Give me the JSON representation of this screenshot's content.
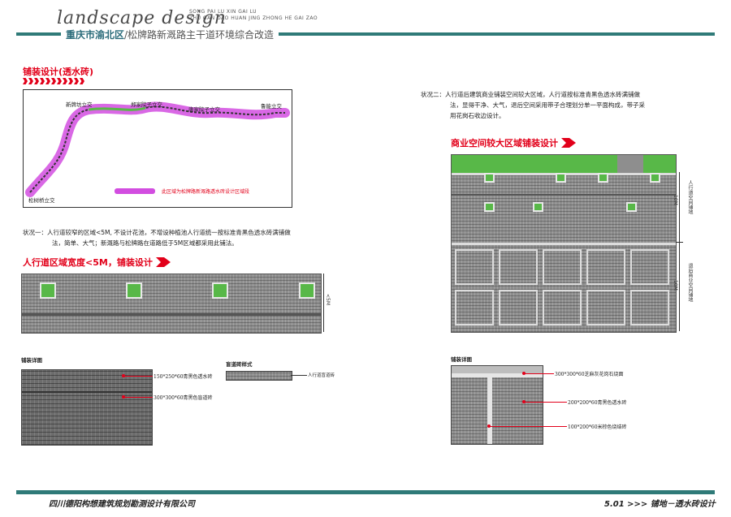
{
  "header": {
    "script_title": "landscape design",
    "pinyin_line1": "SONG PAI LU  XIN GAI LU",
    "pinyin_line2": "ZHU GAN DAO HUAN JING ZHONG HE GAI ZAO",
    "district": "重庆市渝北区",
    "project": "/松牌路新溉路主干道环境综合改造"
  },
  "left": {
    "section_title": "铺装设计(透水砖)",
    "map_labels": {
      "xinpaifang": "新牌坊立交",
      "zhengjiayuanzi": "郑家院子立交",
      "tangjiayuanzi": "唐家院子立交",
      "luxinglijiao": "鲁能立交",
      "songshuqiao": "松树桥立交",
      "legend": "此区域为松牌路新溉路透水砖设计区域段"
    },
    "situation1_line1": "状况一：人行道较窄的区域<5M, 不设计花池，不增设种植池人行道统一按标准青黑色透水砖满铺做",
    "situation1_line2": "法，简单、大气；新溉路与松牌路在道路低于5M区域都采用此铺法。",
    "narrow_title": "人行道区域宽度<5M，铺装设计",
    "width_label": "<5M",
    "detail_label": "铺装详图",
    "callout1": "150*250*60青黑色透水砖",
    "callout2": "300*300*60青黑色盲道砖",
    "blind_label": "盲道砖样式",
    "blind_callout": "人行道盲道砖"
  },
  "right": {
    "situation2_line1": "状况二：人行道后建筑商业铺装空间较大区域，人行道按标准青黑色透水砖满铺做",
    "situation2_line2": "法，显得干净、大气，退后空间采用带子合理划分单一平面构成，带子采",
    "situation2_line3": "用花岗石收边设计。",
    "commercial_title": "商业空间较大区域铺装设计",
    "sidewalk_label": "人行道空间铺地",
    "sidewalk_width": "10M",
    "setback_label": "退后商业空间铺地",
    "setback_width": "10M",
    "detail_label": "铺装详图",
    "callout1": "300*300*60芝麻灰花岗石烧面",
    "callout2": "200*200*60青黑色透水砖",
    "callout3": "100*200*60米棕色烧结砖"
  },
  "footer": {
    "company": "四川德阳构想建筑规划勘测设计有限公司",
    "page": "5.01 >>> 铺地－透水砖设计"
  },
  "colors": {
    "accent": "#2f7a78",
    "red": "#e2001a",
    "green": "#58b848",
    "magenta": "#d24de0"
  }
}
